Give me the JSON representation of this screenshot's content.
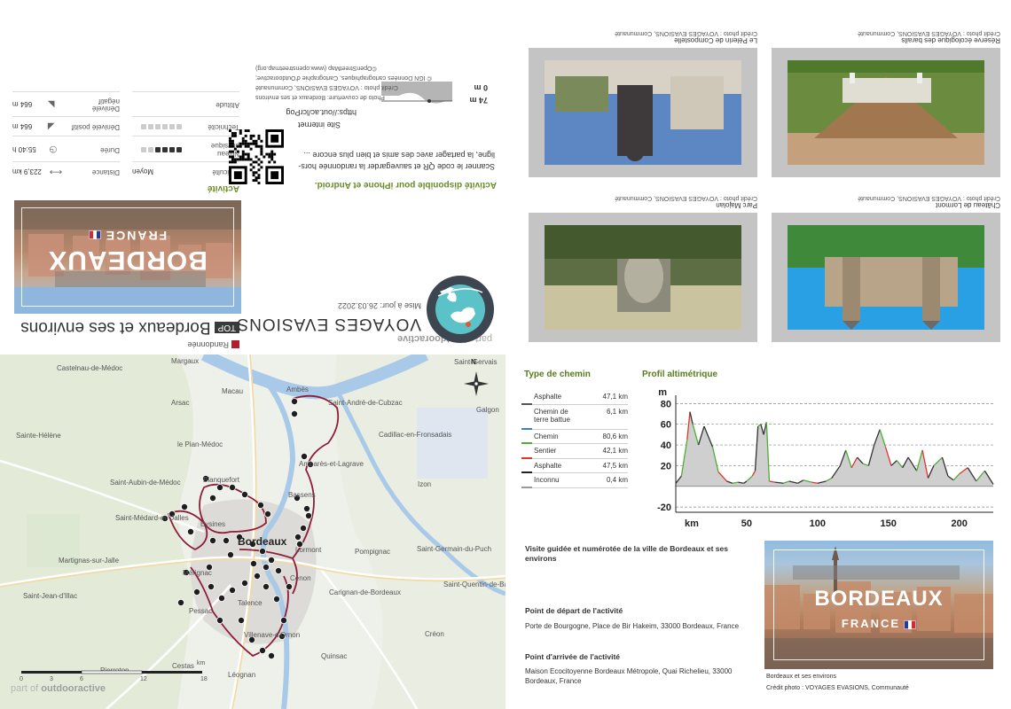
{
  "colors": {
    "accent_green": "#5a7a1f",
    "route": "#8e1d3a",
    "brand_red": "#b11f2e"
  },
  "cover": {
    "branding_prefix": "part of",
    "branding_name": "outdooractive",
    "category": "Randonnée",
    "tour_badge": "TOP",
    "tour_title": "Bordeaux et ses environs",
    "company": "VOYAGES EVASIONS",
    "updated": "Mise à jour: 26.03.2022",
    "cover_title": "BORDEAUX",
    "cover_subtitle": "FRANCE",
    "activity_heading": "Activité",
    "stats": [
      {
        "label": "Difficulté",
        "value": "Moyen",
        "icon": "level-icon"
      },
      {
        "label": "Distance",
        "value": "223,9  km",
        "icon": "distance-icon"
      },
      {
        "label": "Niveau physique",
        "value": "",
        "icon": "dots",
        "dots_on": 4,
        "dots_total": 6
      },
      {
        "label": "Durée",
        "value": "55:40  h",
        "icon": "clock-icon"
      },
      {
        "label": "Technicité",
        "value": "",
        "icon": "dots",
        "dots_on": 0,
        "dots_total": 6
      },
      {
        "label": "Dénivelé positif",
        "value": "664  m",
        "icon": "ascent-icon"
      },
      {
        "label": "Altitude",
        "value": "",
        "icon": "none"
      },
      {
        "label": "Dénivelé négatif",
        "value": "664  m",
        "icon": "descent-icon"
      }
    ],
    "alt_max": "74 m",
    "alt_min": "0 m",
    "app_heading": "Activité disponible pour iPhone et Android.",
    "app_text": "Scanner le code QR et sauvegarder la randonnée hors-ligne, la partager avec des amis et bien plus encore ...",
    "web_heading": "Site internet",
    "web_url": "https://out.ac/lcrPog",
    "credit_1": "Photo de couverture: Bordeaux et ses environs",
    "credit_2": "Crédit photo : VOYAGES EVASIONS, Communauté",
    "credit_3": "© IGN Données cartographiques, Cartographie d'Outdooractive;",
    "credit_4": "©OpenStreetMap (www.openstreetmap.org)"
  },
  "photos": [
    {
      "title": "Réserve écologique des barails",
      "credit": "Crédit photo : VOYAGES EVASIONS, Communauté"
    },
    {
      "title": "Le Pèlerin de Compostelle",
      "credit": "Crédit photo : VOYAGES EVASIONS, Communauté"
    },
    {
      "title": "Château de Lormont",
      "credit": "Crédit photo : VOYAGES EVASIONS, Communauté"
    },
    {
      "title": "Parc Majolan",
      "credit": "Crédit photo : VOYAGES EVASIONS, Communauté"
    }
  ],
  "map": {
    "labels": [
      {
        "t": "Margaux"
      },
      {
        "t": "Castelnau-de-Médoc"
      },
      {
        "t": "Saint-Gervais"
      },
      {
        "t": "Macau"
      },
      {
        "t": "Ambès"
      },
      {
        "t": "Arsac"
      },
      {
        "t": "Saint-André-de-Cubzac"
      },
      {
        "t": "Galgon"
      },
      {
        "t": "Sainte-Hélène"
      },
      {
        "t": "Cadillac-en-Fronsadais"
      },
      {
        "t": "le Pian-Médoc"
      },
      {
        "t": "Ambarès-et-Lagrave"
      },
      {
        "t": "Saint-Aubin-de-Médoc"
      },
      {
        "t": "Blanquefort"
      },
      {
        "t": "Izon"
      },
      {
        "t": "Bassens"
      },
      {
        "t": "Saint-Médard-en-Jalles"
      },
      {
        "t": "Eysines"
      },
      {
        "t": "Bordeaux"
      },
      {
        "t": "Lormont"
      },
      {
        "t": "Saint-Germain-du-Puch"
      },
      {
        "t": "Pompignac"
      },
      {
        "t": "Martignas-sur-Jalle"
      },
      {
        "t": "Mérignac"
      },
      {
        "t": "Saint-Jean-d'Illac"
      },
      {
        "t": "Cenon"
      },
      {
        "t": "Saint-Quentin-de-Baron"
      },
      {
        "t": "Carignan-de-Bordeaux"
      },
      {
        "t": "Pessac"
      },
      {
        "t": "Talence"
      },
      {
        "t": "Villenave-d'Ornon"
      },
      {
        "t": "Créon"
      },
      {
        "t": "Quinsac"
      },
      {
        "t": "Cestas"
      },
      {
        "t": "Pierroton"
      },
      {
        "t": "Léognan"
      }
    ],
    "scale_ticks": [
      "0",
      "3",
      "6",
      "12",
      "18"
    ],
    "scale_unit": "km",
    "branding_prefix": "part of",
    "branding_name": "outdooractive",
    "north_label": "N"
  },
  "surface": {
    "heading": "Type de chemin",
    "rows": [
      {
        "name": "Asphalte",
        "km": "47,1 km",
        "color": "#555555"
      },
      {
        "name": "Chemin de terre battue",
        "km": "6,1 km",
        "color": "#3c7fc9"
      },
      {
        "name": "Chemin",
        "km": "80,6 km",
        "color": "#4caf32"
      },
      {
        "name": "Sentier",
        "km": "42,1 km",
        "color": "#e0342d"
      },
      {
        "name": "Asphalte",
        "km": "47,5 km",
        "color": "#222222"
      },
      {
        "name": "Inconnu",
        "km": "0,4 km",
        "color": "#999999"
      }
    ]
  },
  "profile": {
    "heading": "Profil altimétrique",
    "y_unit": "m",
    "x_unit": "km",
    "y_ticks": [
      80,
      60,
      40,
      20,
      -20
    ],
    "x_ticks": [
      50,
      100,
      150,
      200
    ]
  },
  "info": {
    "description": "Visite guidée et numérotée de la ville de Bordeaux et ses environs",
    "start_heading": "Point de départ de l'activité",
    "start_value": "Porte de Bourgogne, Place de Bir Hakeim, 33000 Bordeaux, France",
    "end_heading": "Point d'arrivée de l'activité",
    "end_value": "Maison Ecocitoyenne Bordeaux Métropole, Quai Richelieu, 33000 Bordeaux, France",
    "image_title": "BORDEAUX",
    "image_subtitle": "FRANCE",
    "image_caption": "Bordeaux et ses environs",
    "image_credit": "Crédit photo : VOYAGES EVASIONS, Communauté"
  },
  "chart_data": {
    "type": "area",
    "title": "Profil altimétrique",
    "xlabel": "km",
    "ylabel": "m",
    "xlim": [
      0,
      224
    ],
    "ylim": [
      -25,
      88
    ],
    "x": [
      0,
      4,
      8,
      10,
      12,
      16,
      20,
      26,
      30,
      36,
      40,
      44,
      48,
      50,
      54,
      56,
      58,
      60,
      62,
      64,
      66,
      70,
      76,
      80,
      86,
      90,
      96,
      100,
      106,
      110,
      116,
      120,
      124,
      128,
      132,
      136,
      140,
      144,
      148,
      152,
      156,
      160,
      164,
      170,
      174,
      178,
      182,
      188,
      192,
      196,
      200,
      206,
      212,
      218,
      224
    ],
    "y": [
      3,
      10,
      45,
      72,
      60,
      40,
      58,
      38,
      14,
      5,
      3,
      4,
      3,
      5,
      10,
      15,
      58,
      60,
      50,
      62,
      5,
      4,
      3,
      5,
      3,
      6,
      4,
      3,
      5,
      8,
      20,
      35,
      18,
      28,
      22,
      20,
      40,
      55,
      38,
      20,
      25,
      18,
      28,
      15,
      35,
      8,
      20,
      28,
      10,
      6,
      12,
      18,
      5,
      15,
      2
    ]
  }
}
